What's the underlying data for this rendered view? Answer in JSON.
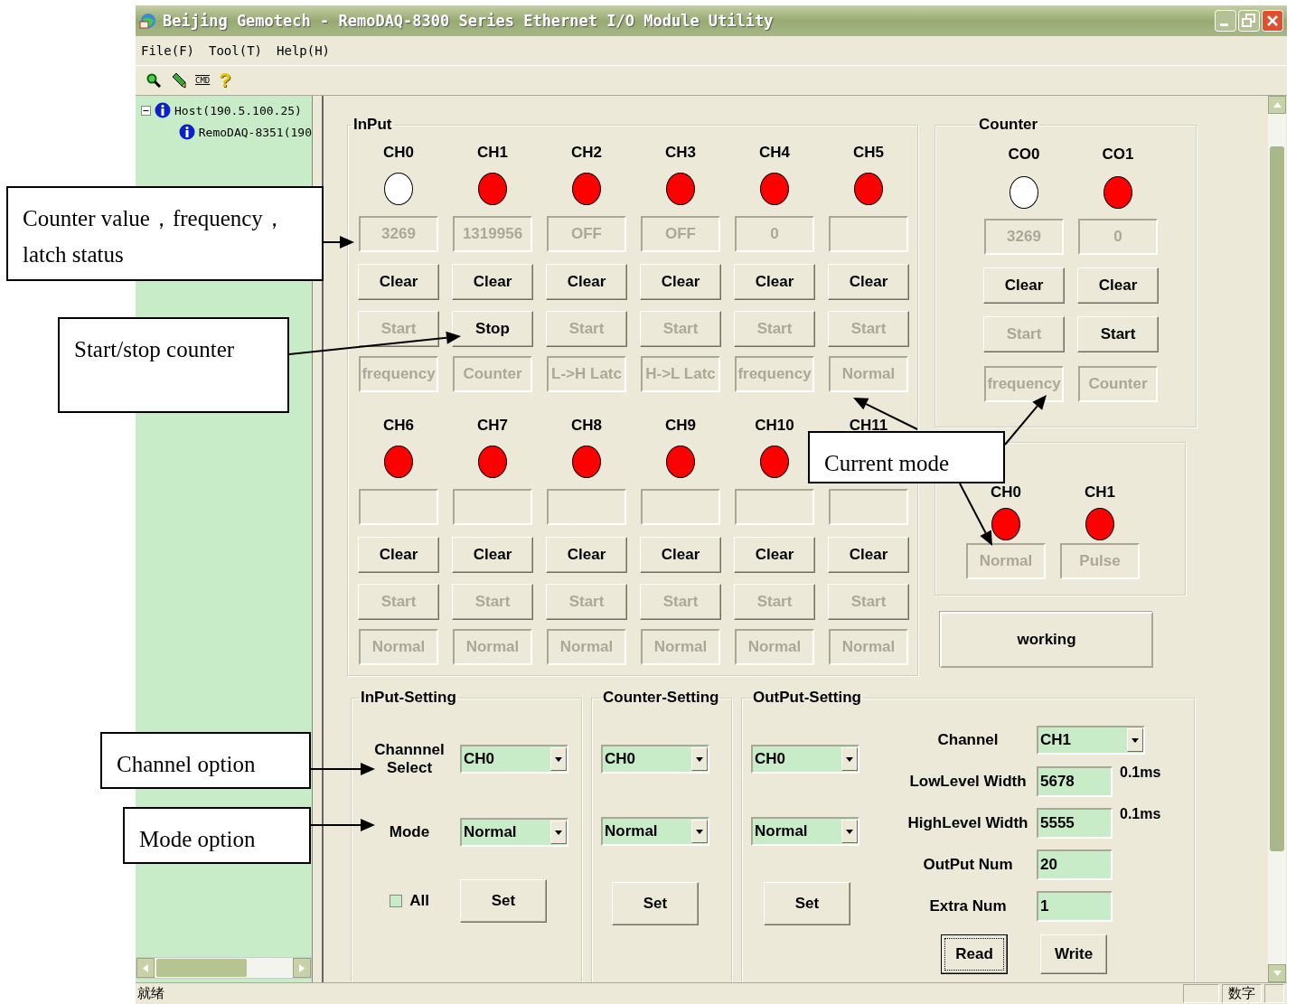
{
  "window": {
    "title": "Beijing Gemotech - RemoDAQ-8300 Series Ethernet I/O Module Utility"
  },
  "menu": [
    "File(F)",
    "Tool(T)",
    "Help(H)"
  ],
  "toolbar": [
    {
      "kind": "search"
    },
    {
      "kind": "pencil"
    },
    {
      "kind": "label",
      "label": "CMD"
    },
    {
      "kind": "glyph",
      "label": "?"
    }
  ],
  "tree": [
    {
      "label": "Host(190.5.100.25)",
      "expanded": true,
      "children": [
        {
          "label": "RemoDAQ-8351(190"
        }
      ]
    }
  ],
  "input": {
    "title": "InPut",
    "channels": [
      {
        "label": "CH0",
        "color": "#ffffff",
        "value": "3269",
        "clear": "Clear",
        "start": {
          "label": "Start",
          "disabled": true
        },
        "mode": "frequency"
      },
      {
        "label": "CH1",
        "color": "#ff0000",
        "value": "1319956",
        "clear": "Clear",
        "start": {
          "label": "Stop",
          "disabled": false
        },
        "mode": "Counter"
      },
      {
        "label": "CH2",
        "color": "#ff0000",
        "value": "OFF",
        "clear": "Clear",
        "start": {
          "label": "Start",
          "disabled": true
        },
        "mode": "L->H Latc"
      },
      {
        "label": "CH3",
        "color": "#ff0000",
        "value": "OFF",
        "clear": "Clear",
        "start": {
          "label": "Start",
          "disabled": true
        },
        "mode": "H->L Latc"
      },
      {
        "label": "CH4",
        "color": "#ff0000",
        "value": "0",
        "clear": "Clear",
        "start": {
          "label": "Start",
          "disabled": true
        },
        "mode": "frequency"
      },
      {
        "label": "CH5",
        "color": "#ff0000",
        "clear": "Clear",
        "start": {
          "label": "Start",
          "disabled": true
        },
        "mode": "Normal"
      },
      {
        "label": "CH6",
        "color": "#ff0000",
        "clear": "Clear",
        "start": {
          "label": "Start",
          "disabled": true
        },
        "mode": "Normal"
      },
      {
        "label": "CH7",
        "color": "#ff0000",
        "clear": "Clear",
        "start": {
          "label": "Start",
          "disabled": true
        },
        "mode": "Normal"
      },
      {
        "label": "CH8",
        "color": "#ff0000",
        "clear": "Clear",
        "start": {
          "label": "Start",
          "disabled": true
        },
        "mode": "Normal"
      },
      {
        "label": "CH9",
        "color": "#ff0000",
        "clear": "Clear",
        "start": {
          "label": "Start",
          "disabled": true
        },
        "mode": "Normal"
      },
      {
        "label": "CH10",
        "color": "#ff0000",
        "clear": "Clear",
        "start": {
          "label": "Start",
          "disabled": true
        },
        "mode": "Normal"
      },
      {
        "label": "CH11",
        "clear": "Clear",
        "start": {
          "label": "Start",
          "disabled": true
        },
        "mode": "Normal"
      }
    ]
  },
  "counter": {
    "title": "Counter",
    "channels": [
      {
        "label": "CO0",
        "color": "#ffffff",
        "value": "3269",
        "clear": "Clear",
        "start": {
          "label": "Start",
          "disabled": true
        },
        "mode": "frequency"
      },
      {
        "label": "CO1",
        "color": "#ff0000",
        "value": "0",
        "clear": "Clear",
        "start": {
          "label": "Start",
          "disabled": false
        },
        "mode": "Counter"
      }
    ]
  },
  "output": {
    "channels": [
      {
        "label": "CH0",
        "color": "#ff0000",
        "mode": "Normal"
      },
      {
        "label": "CH1",
        "color": "#ff0000",
        "mode": "Pulse"
      }
    ]
  },
  "status_box": "working",
  "input_setting": {
    "title": "InPut-Setting",
    "channel_label": "Channnel Select",
    "channel": "CH0",
    "mode_label": "Mode",
    "mode": "Normal",
    "all": {
      "label": "All",
      "checked": false
    },
    "button": "Set"
  },
  "counter_setting": {
    "title": "Counter-Setting",
    "channel": "CH0",
    "mode": "Normal",
    "button": "Set"
  },
  "output_setting": {
    "title": "OutPut-Setting",
    "channel": "CH0",
    "mode": "Normal",
    "button": "Set",
    "channel_label": "Channel",
    "pulse_channel": "CH1",
    "params": [
      {
        "label": "LowLevel Width",
        "value": "5678",
        "unit": "0.1ms"
      },
      {
        "label": "HighLevel Width",
        "value": "5555",
        "unit": "0.1ms"
      },
      {
        "label": "OutPut Num",
        "value": "20"
      },
      {
        "label": "Extra Num",
        "value": "1"
      }
    ],
    "buttons": [
      {
        "label": "Read",
        "focused": true
      },
      {
        "label": "Write",
        "focused": false
      }
    ]
  },
  "status_bar": [
    "就绪",
    "数字"
  ],
  "annotations": [
    {
      "text": "Counter value，frequency，latch status"
    },
    {
      "text": "Start/stop counter"
    },
    {
      "text": "Current mode"
    },
    {
      "text": "Channel option"
    },
    {
      "text": "Mode option"
    }
  ]
}
